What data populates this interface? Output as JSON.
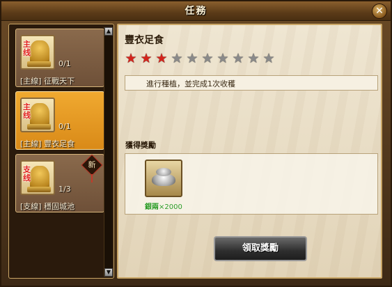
{
  "window": {
    "title": "任務"
  },
  "quests": [
    {
      "type": "主\n线",
      "progress": "0/1",
      "name": "[主線] 征戰天下",
      "selected": false,
      "is_new": false
    },
    {
      "type": "主\n线",
      "progress": "0/1",
      "name": "[主線] 豐衣足食",
      "selected": true,
      "is_new": false
    },
    {
      "type": "支\n线",
      "progress": "1/3",
      "name": "[支線] 穩固城池",
      "selected": false,
      "is_new": true
    }
  ],
  "new_badge": "新",
  "detail": {
    "title": "豐衣足食",
    "stars_total": 10,
    "stars_filled": 3,
    "description": "進行種植，並完成1次收穫",
    "reward_label": "獲得獎勵",
    "reward": {
      "icon": "silver-ingot-icon",
      "name": "銀兩",
      "amount": "×2000"
    },
    "claim_label": "領取獎勵"
  },
  "colors": {
    "star_on": "#d4241c",
    "star_off": "#8a8a8a",
    "reward_text": "#2a9a22"
  }
}
